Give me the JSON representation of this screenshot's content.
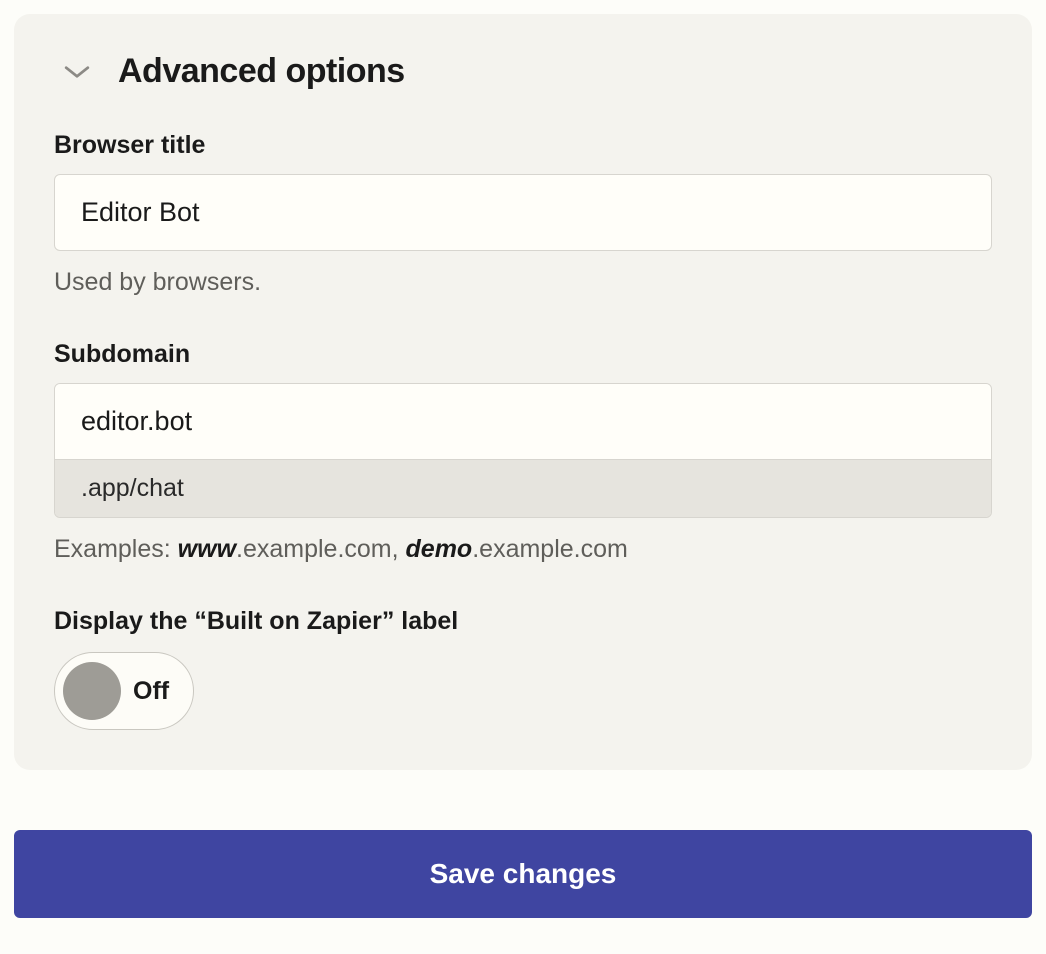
{
  "section": {
    "title": "Advanced options"
  },
  "browser_title": {
    "label": "Browser title",
    "value": "Editor Bot",
    "helper": "Used by browsers."
  },
  "subdomain": {
    "label": "Subdomain",
    "value": "editor.bot",
    "suffix": ".app/chat",
    "helper_prefix": "Examples: ",
    "helper_bold1": "www",
    "helper_mid1": ".example.com, ",
    "helper_bold2": "demo",
    "helper_mid2": ".example.com"
  },
  "built_on_label": {
    "label": "Display the “Built on Zapier” label",
    "state": "Off"
  },
  "actions": {
    "save": "Save changes"
  }
}
